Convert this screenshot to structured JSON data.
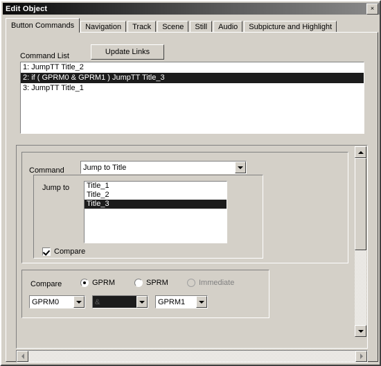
{
  "window": {
    "title": "Edit Object",
    "close_label": "×"
  },
  "tabs": [
    {
      "label": "Button Commands",
      "active": true
    },
    {
      "label": "Navigation",
      "active": false
    },
    {
      "label": "Track",
      "active": false
    },
    {
      "label": "Scene",
      "active": false
    },
    {
      "label": "Still",
      "active": false
    },
    {
      "label": "Audio",
      "active": false
    },
    {
      "label": "Subpicture and Highlight",
      "active": false
    }
  ],
  "command_list": {
    "label": "Command List",
    "update_links_label": "Update Links",
    "rows": [
      {
        "text": "1: JumpTT Title_2",
        "selected": false
      },
      {
        "text": "2: if ( GPRM0 & GPRM1 ) JumpTT Title_3",
        "selected": true
      },
      {
        "text": "3: JumpTT Title_1",
        "selected": false
      }
    ]
  },
  "command_panel": {
    "command_label": "Command",
    "command_value": "Jump to Title",
    "jump_to_label": "Jump to",
    "jump_to_items": [
      {
        "text": "Title_1",
        "selected": false
      },
      {
        "text": "Title_2",
        "selected": false
      },
      {
        "text": "Title_3",
        "selected": true
      }
    ],
    "compare_checkbox_label": "Compare",
    "compare_checked": true
  },
  "compare_group": {
    "label": "Compare",
    "radios": [
      {
        "label": "GPRM",
        "selected": true,
        "disabled": false
      },
      {
        "label": "SPRM",
        "selected": false,
        "disabled": false
      },
      {
        "label": "Immediate",
        "selected": false,
        "disabled": true
      }
    ],
    "operand_left": "GPRM0",
    "operator": "&",
    "operand_right": "GPRM1"
  },
  "scrollbars": {
    "up_arrow": "scroll-up",
    "down_arrow": "scroll-down",
    "left_arrow": "scroll-left",
    "right_arrow": "scroll-right"
  }
}
